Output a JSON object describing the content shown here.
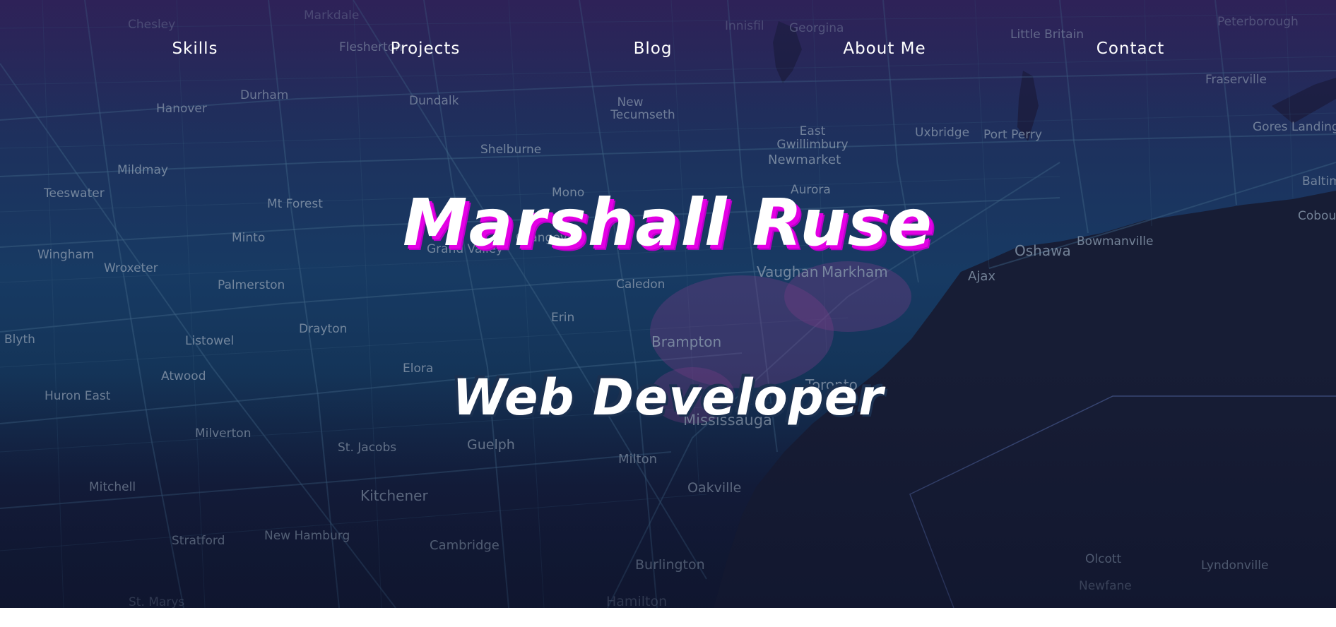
{
  "nav": {
    "items": [
      {
        "label": "Skills"
      },
      {
        "label": "Projects"
      },
      {
        "label": "Blog"
      },
      {
        "label": "About Me"
      },
      {
        "label": "Contact"
      }
    ]
  },
  "hero": {
    "name": "Marshall Ruse",
    "role": "Web Developer"
  },
  "map": {
    "places": [
      "Chesley",
      "Markdale",
      "Flesherton",
      "Innisfil",
      "Georgina",
      "Little Britain",
      "Peterborough",
      "Hanover",
      "Durham",
      "Dundalk",
      "New Tecumseth",
      "Fraserville",
      "Mildmay",
      "Shelburne",
      "East Gwillimbury",
      "Uxbridge",
      "Port Perry",
      "Gores Landing",
      "Newmarket",
      "Teeswater",
      "Mono",
      "Aurora",
      "Baltim",
      "Mt Forest",
      "Cobou",
      "Minto",
      "Orangeville",
      "Grand Valley",
      "Oshawa",
      "Bowmanville",
      "Wingham",
      "Wroxeter",
      "Vaughan",
      "Markham",
      "Ajax",
      "Palmerston",
      "Caledon",
      "Erin",
      "Drayton",
      "Blyth",
      "Listowel",
      "Brampton",
      "Elora",
      "Atwood",
      "Toronto",
      "Huron East",
      "Mississauga",
      "Milverton",
      "St. Jacobs",
      "Guelph",
      "Milton",
      "Mitchell",
      "Oakville",
      "Kitchener",
      "Stratford",
      "New Hamburg",
      "Cambridge",
      "Burlington",
      "Olcott",
      "Lyndonville",
      "Newfane",
      "St. Marys",
      "Hamilton"
    ]
  }
}
